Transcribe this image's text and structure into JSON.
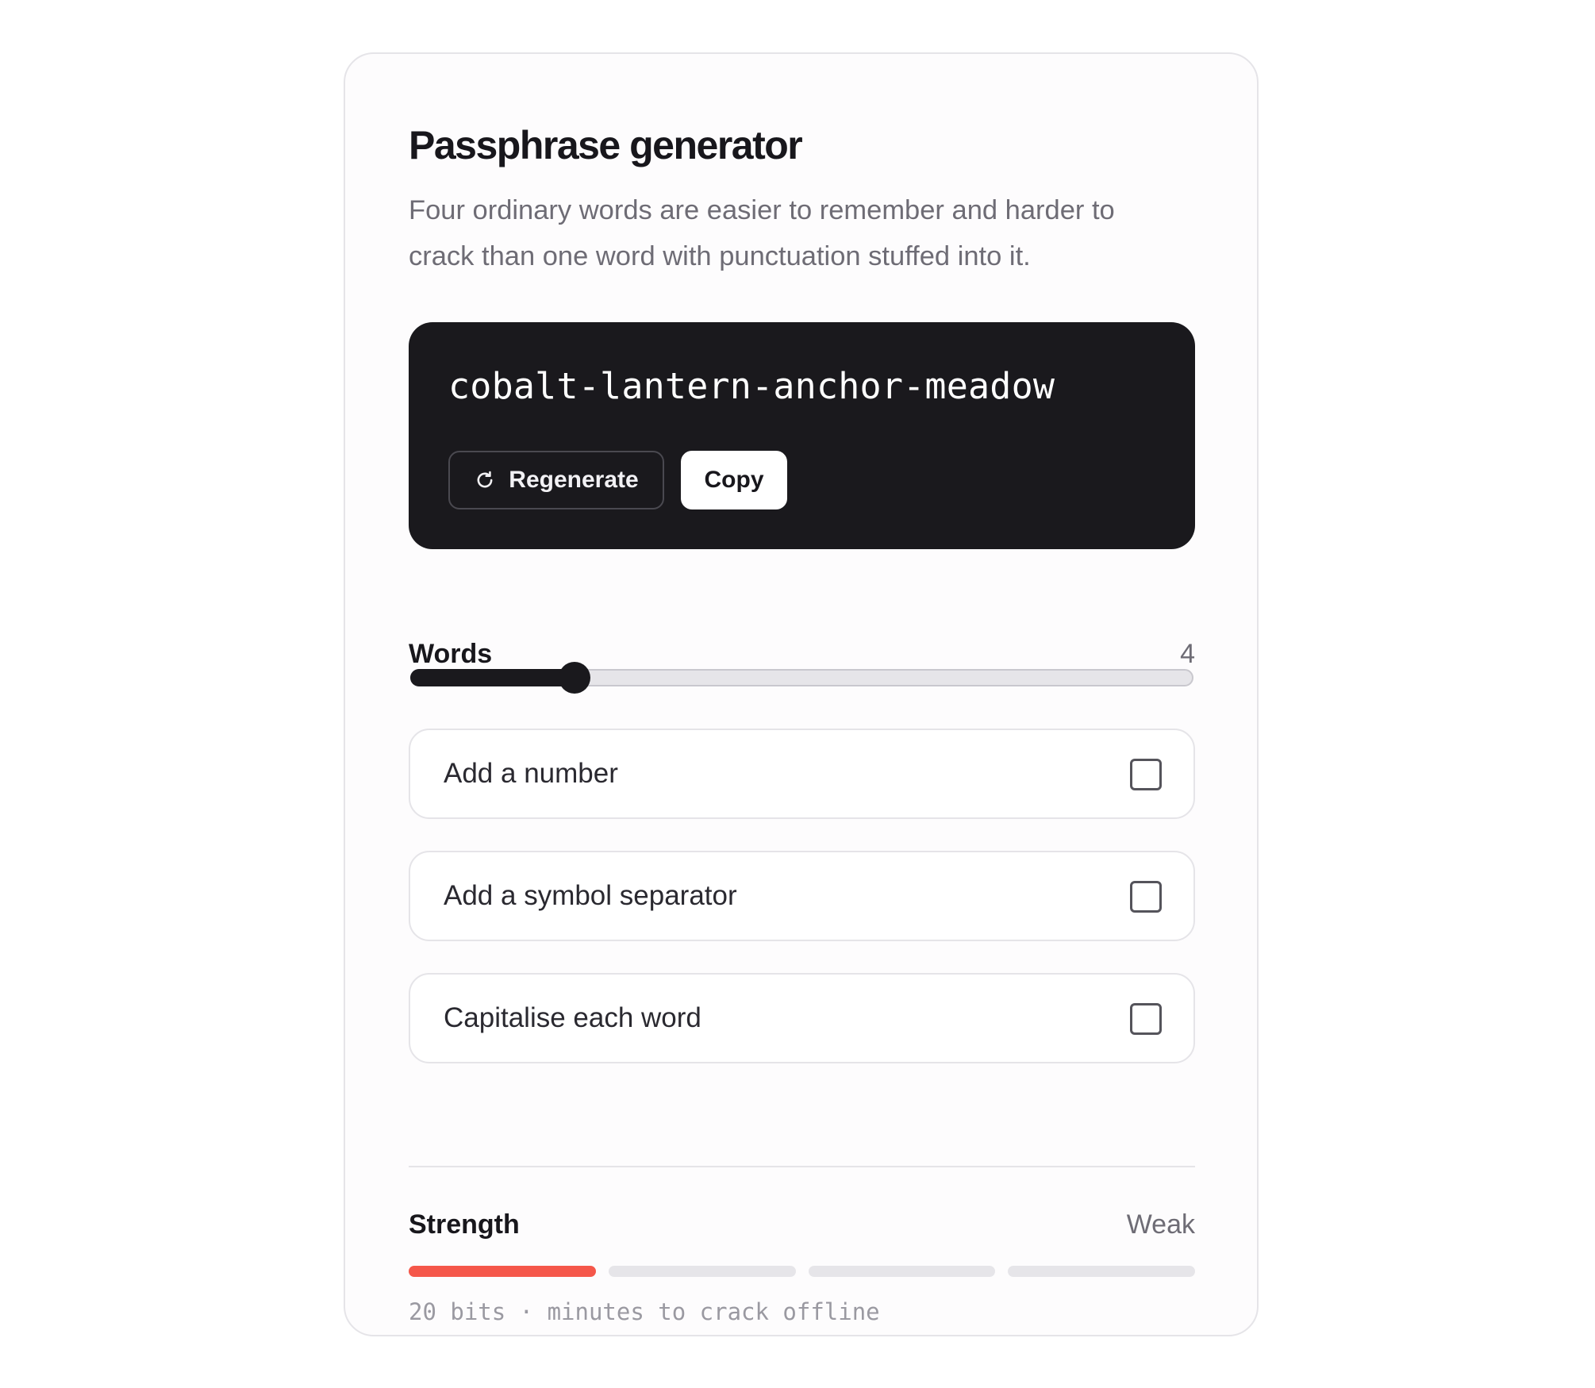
{
  "header": {
    "title": "Passphrase generator",
    "subtitle": "Four ordinary words are easier to remember and harder to crack than one word with punctuation stuffed into it."
  },
  "output": {
    "passphrase": "cobalt-lantern-anchor-meadow",
    "regenerate_label": "Regenerate",
    "regenerate_icon": "refresh-icon",
    "copy_label": "Copy"
  },
  "words": {
    "label": "Words",
    "value": "4",
    "slider_fraction": 0.21
  },
  "options": [
    {
      "label": "Add a number",
      "checked": false
    },
    {
      "label": "Add a symbol separator",
      "checked": false
    },
    {
      "label": "Capitalise each word",
      "checked": false
    }
  ],
  "strength": {
    "label": "Strength",
    "rating": "Weak",
    "segments_total": 4,
    "segments_filled": 1,
    "filled_color": "#f5574a",
    "empty_color": "#e6e5e9",
    "detail": "20 bits · minutes to crack offline"
  }
}
